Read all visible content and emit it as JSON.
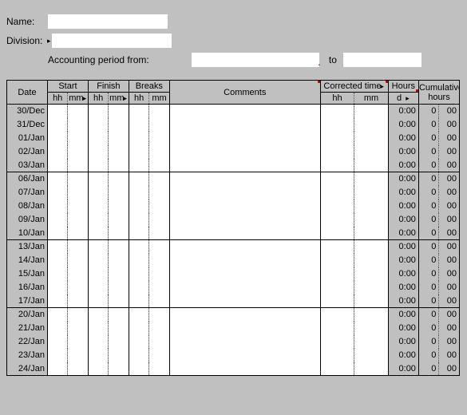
{
  "form": {
    "name_label": "Name:",
    "name_value": "",
    "division_label": "Division:",
    "division_value": "",
    "period_label": "Accounting period from:",
    "period_from": "",
    "to_label": "to",
    "period_to": ""
  },
  "headers": {
    "date": "Date",
    "start": "Start",
    "finish": "Finish",
    "breaks": "Breaks",
    "comments": "Comments",
    "corrected_time": "Corrected time",
    "hours": "Hours",
    "cumulative": "Cumulative hours",
    "hh": "hh",
    "mm": "mm",
    "d": "d",
    "arrow": "▸"
  },
  "rows": [
    {
      "date": "30/Dec",
      "hours": "0:00",
      "cumA": "0",
      "cumB": "00",
      "wk": false
    },
    {
      "date": "31/Dec",
      "hours": "0:00",
      "cumA": "0",
      "cumB": "00",
      "wk": false
    },
    {
      "date": "01/Jan",
      "hours": "0:00",
      "cumA": "0",
      "cumB": "00",
      "wk": false
    },
    {
      "date": "02/Jan",
      "hours": "0:00",
      "cumA": "0",
      "cumB": "00",
      "wk": false
    },
    {
      "date": "03/Jan",
      "hours": "0:00",
      "cumA": "0",
      "cumB": "00",
      "wk": true
    },
    {
      "date": "06/Jan",
      "hours": "0:00",
      "cumA": "0",
      "cumB": "00",
      "wk": false
    },
    {
      "date": "07/Jan",
      "hours": "0:00",
      "cumA": "0",
      "cumB": "00",
      "wk": false
    },
    {
      "date": "08/Jan",
      "hours": "0:00",
      "cumA": "0",
      "cumB": "00",
      "wk": false
    },
    {
      "date": "09/Jan",
      "hours": "0:00",
      "cumA": "0",
      "cumB": "00",
      "wk": false
    },
    {
      "date": "10/Jan",
      "hours": "0:00",
      "cumA": "0",
      "cumB": "00",
      "wk": true
    },
    {
      "date": "13/Jan",
      "hours": "0:00",
      "cumA": "0",
      "cumB": "00",
      "wk": false
    },
    {
      "date": "14/Jan",
      "hours": "0:00",
      "cumA": "0",
      "cumB": "00",
      "wk": false
    },
    {
      "date": "15/Jan",
      "hours": "0:00",
      "cumA": "0",
      "cumB": "00",
      "wk": false
    },
    {
      "date": "16/Jan",
      "hours": "0:00",
      "cumB": "00",
      "cumA": "0",
      "wk": false
    },
    {
      "date": "17/Jan",
      "hours": "0:00",
      "cumA": "0",
      "cumB": "00",
      "wk": true
    },
    {
      "date": "20/Jan",
      "hours": "0:00",
      "cumA": "0",
      "cumB": "00",
      "wk": false
    },
    {
      "date": "21/Jan",
      "hours": "0:00",
      "cumA": "0",
      "cumB": "00",
      "wk": false
    },
    {
      "date": "22/Jan",
      "hours": "0:00",
      "cumA": "0",
      "cumB": "00",
      "wk": false
    },
    {
      "date": "23/Jan",
      "hours": "0:00",
      "cumA": "0",
      "cumB": "00",
      "wk": false
    },
    {
      "date": "24/Jan",
      "hours": "0:00",
      "cumA": "0",
      "cumB": "00",
      "wk": false
    }
  ]
}
